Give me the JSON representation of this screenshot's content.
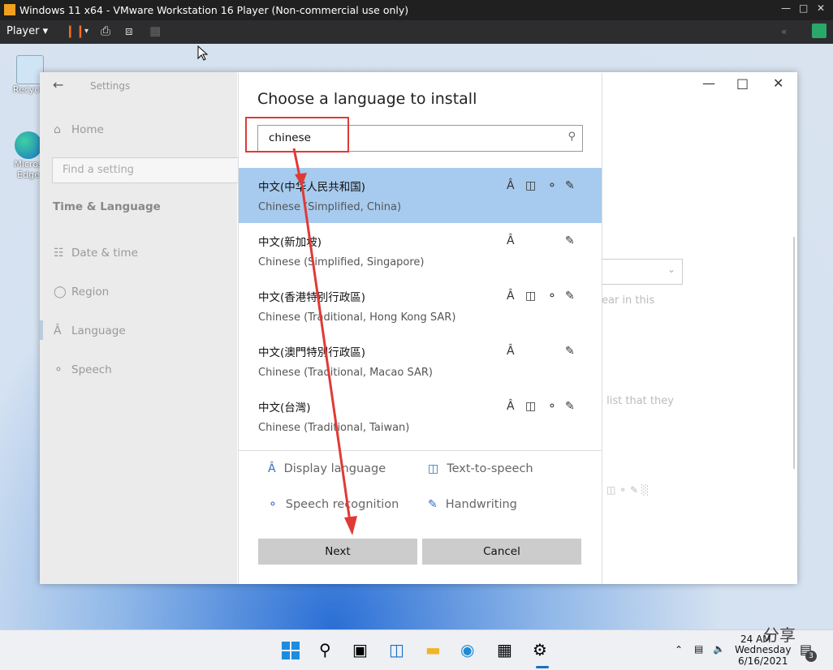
{
  "vm": {
    "title": "Windows 11 x64 - VMware Workstation 16 Player (Non-commercial use only)",
    "player_menu": "Player"
  },
  "desktop": {
    "icons": [
      {
        "label": "Recycle",
        "icon": "recycle-bin-icon"
      },
      {
        "label": "Micros Edge",
        "icon": "edge-icon"
      }
    ]
  },
  "settings": {
    "title": "Settings",
    "home": "Home",
    "search_placeholder": "Find a setting",
    "section": "Time & Language",
    "nav": [
      {
        "label": "Date & time",
        "icon": "clock-calendar-icon"
      },
      {
        "label": "Region",
        "icon": "globe-icon"
      },
      {
        "label": "Language",
        "icon": "language-icon"
      },
      {
        "label": "Speech",
        "icon": "microphone-icon"
      }
    ],
    "bg_fragments": [
      "ear in this",
      "e list that they"
    ]
  },
  "dialog": {
    "title": "Choose a language to install",
    "search_value": "chinese",
    "languages": [
      {
        "native": "中文(中华人民共和国)",
        "english": "Chinese (Simplified, China)",
        "selected": true,
        "features": [
          "display",
          "tts",
          "speech",
          "handwriting"
        ]
      },
      {
        "native": "中文(新加坡)",
        "english": "Chinese (Simplified, Singapore)",
        "selected": false,
        "features": [
          "display",
          "handwriting"
        ]
      },
      {
        "native": "中文(香港特別行政區)",
        "english": "Chinese (Traditional, Hong Kong SAR)",
        "selected": false,
        "features": [
          "display",
          "tts",
          "speech",
          "handwriting"
        ]
      },
      {
        "native": "中文(澳門特別行政區)",
        "english": "Chinese (Traditional, Macao SAR)",
        "selected": false,
        "features": [
          "display",
          "handwriting"
        ]
      },
      {
        "native": "中文(台灣)",
        "english": "Chinese (Traditional, Taiwan)",
        "selected": false,
        "features": [
          "display",
          "tts",
          "speech",
          "handwriting"
        ]
      }
    ],
    "legend": {
      "display": "Display language",
      "tts": "Text-to-speech",
      "speech": "Speech recognition",
      "handwriting": "Handwriting"
    },
    "next_label": "Next",
    "cancel_label": "Cancel"
  },
  "taskbar": {
    "time": "24 AM",
    "day": "Wednesday",
    "date": "6/16/2021",
    "notification_count": "3",
    "watermark": "分享"
  },
  "colors": {
    "selected_row": "#a7cbee",
    "annotation": "#e03a36",
    "accent": "#2f6fc4"
  }
}
